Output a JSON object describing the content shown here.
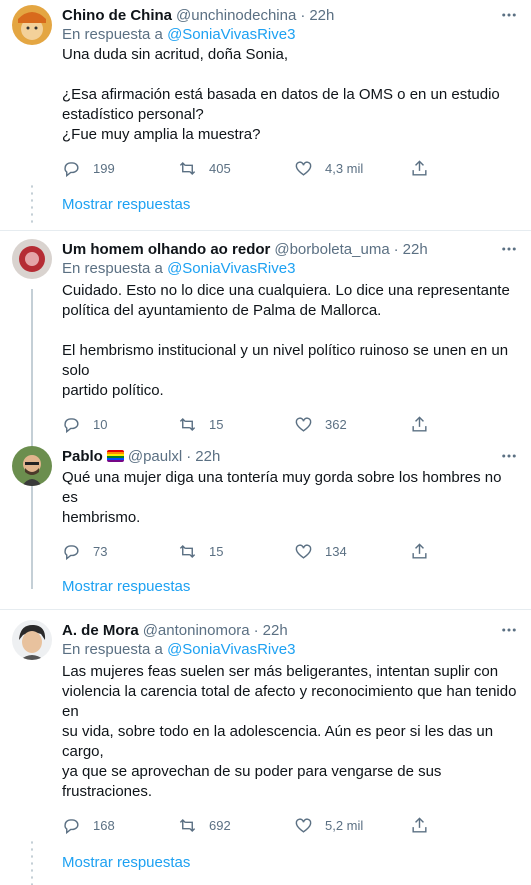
{
  "tweets": [
    {
      "name": "Chino de China",
      "handle": "@unchinodechina",
      "dot": "·",
      "time": "22h",
      "reply_prefix": "En respuesta a",
      "reply_mention": "@SoniaVivasRive3",
      "lines_1": [
        "Una duda sin acritud, doña Sonia,"
      ],
      "lines_2": [
        "¿Esa afirmación está basada en datos de la OMS o en un estudio",
        "estadístico personal?",
        "¿Fue muy amplia la muestra?"
      ],
      "replies": "199",
      "retweets": "405",
      "likes": "4,3 mil",
      "show_more": "Mostrar respuestas"
    },
    {
      "name": "Um homem olhando ao redor",
      "handle": "@borboleta_uma",
      "dot": "·",
      "time": "22h",
      "reply_prefix": "En respuesta a",
      "reply_mention": "@SoniaVivasRive3",
      "lines_1": [
        "Cuidado. Esto no lo dice una cualquiera. Lo dice una representante",
        "política del ayuntamiento de Palma de Mallorca."
      ],
      "lines_2": [
        "El hembrismo institucional y un nivel político ruinoso se unen en un solo",
        "partido político."
      ],
      "replies": "10",
      "retweets": "15",
      "likes": "362"
    },
    {
      "name": "Pablo",
      "handle": "@paulxl",
      "dot": "·",
      "time": "22h",
      "lines_1": [
        "Qué una mujer diga una tontería muy gorda sobre los hombres no es",
        "hembrismo."
      ],
      "replies": "73",
      "retweets": "15",
      "likes": "134",
      "show_more": "Mostrar respuestas"
    },
    {
      "name": "A. de Mora",
      "handle": "@antoninomora",
      "dot": "·",
      "time": "22h",
      "reply_prefix": "En respuesta a",
      "reply_mention": "@SoniaVivasRive3",
      "lines_1": [
        "Las mujeres feas suelen ser más beligerantes, intentan suplir con",
        "violencia la carencia total de afecto y reconocimiento que han tenido en",
        "su vida, sobre todo en la adolescencia. Aún es peor si les das un cargo,",
        "ya que se aprovechan de su poder para vengarse de sus frustraciones."
      ],
      "replies": "168",
      "retweets": "692",
      "likes": "5,2 mil",
      "show_more": "Mostrar respuestas"
    }
  ],
  "colors": {
    "accent": "#1da1f2",
    "muted": "#5b7083",
    "text": "#0f1419",
    "border": "#e6ecf0"
  },
  "icons": [
    "reply-icon",
    "retweet-icon",
    "like-icon",
    "share-icon",
    "more-icon",
    "rainbow-flag-icon"
  ]
}
